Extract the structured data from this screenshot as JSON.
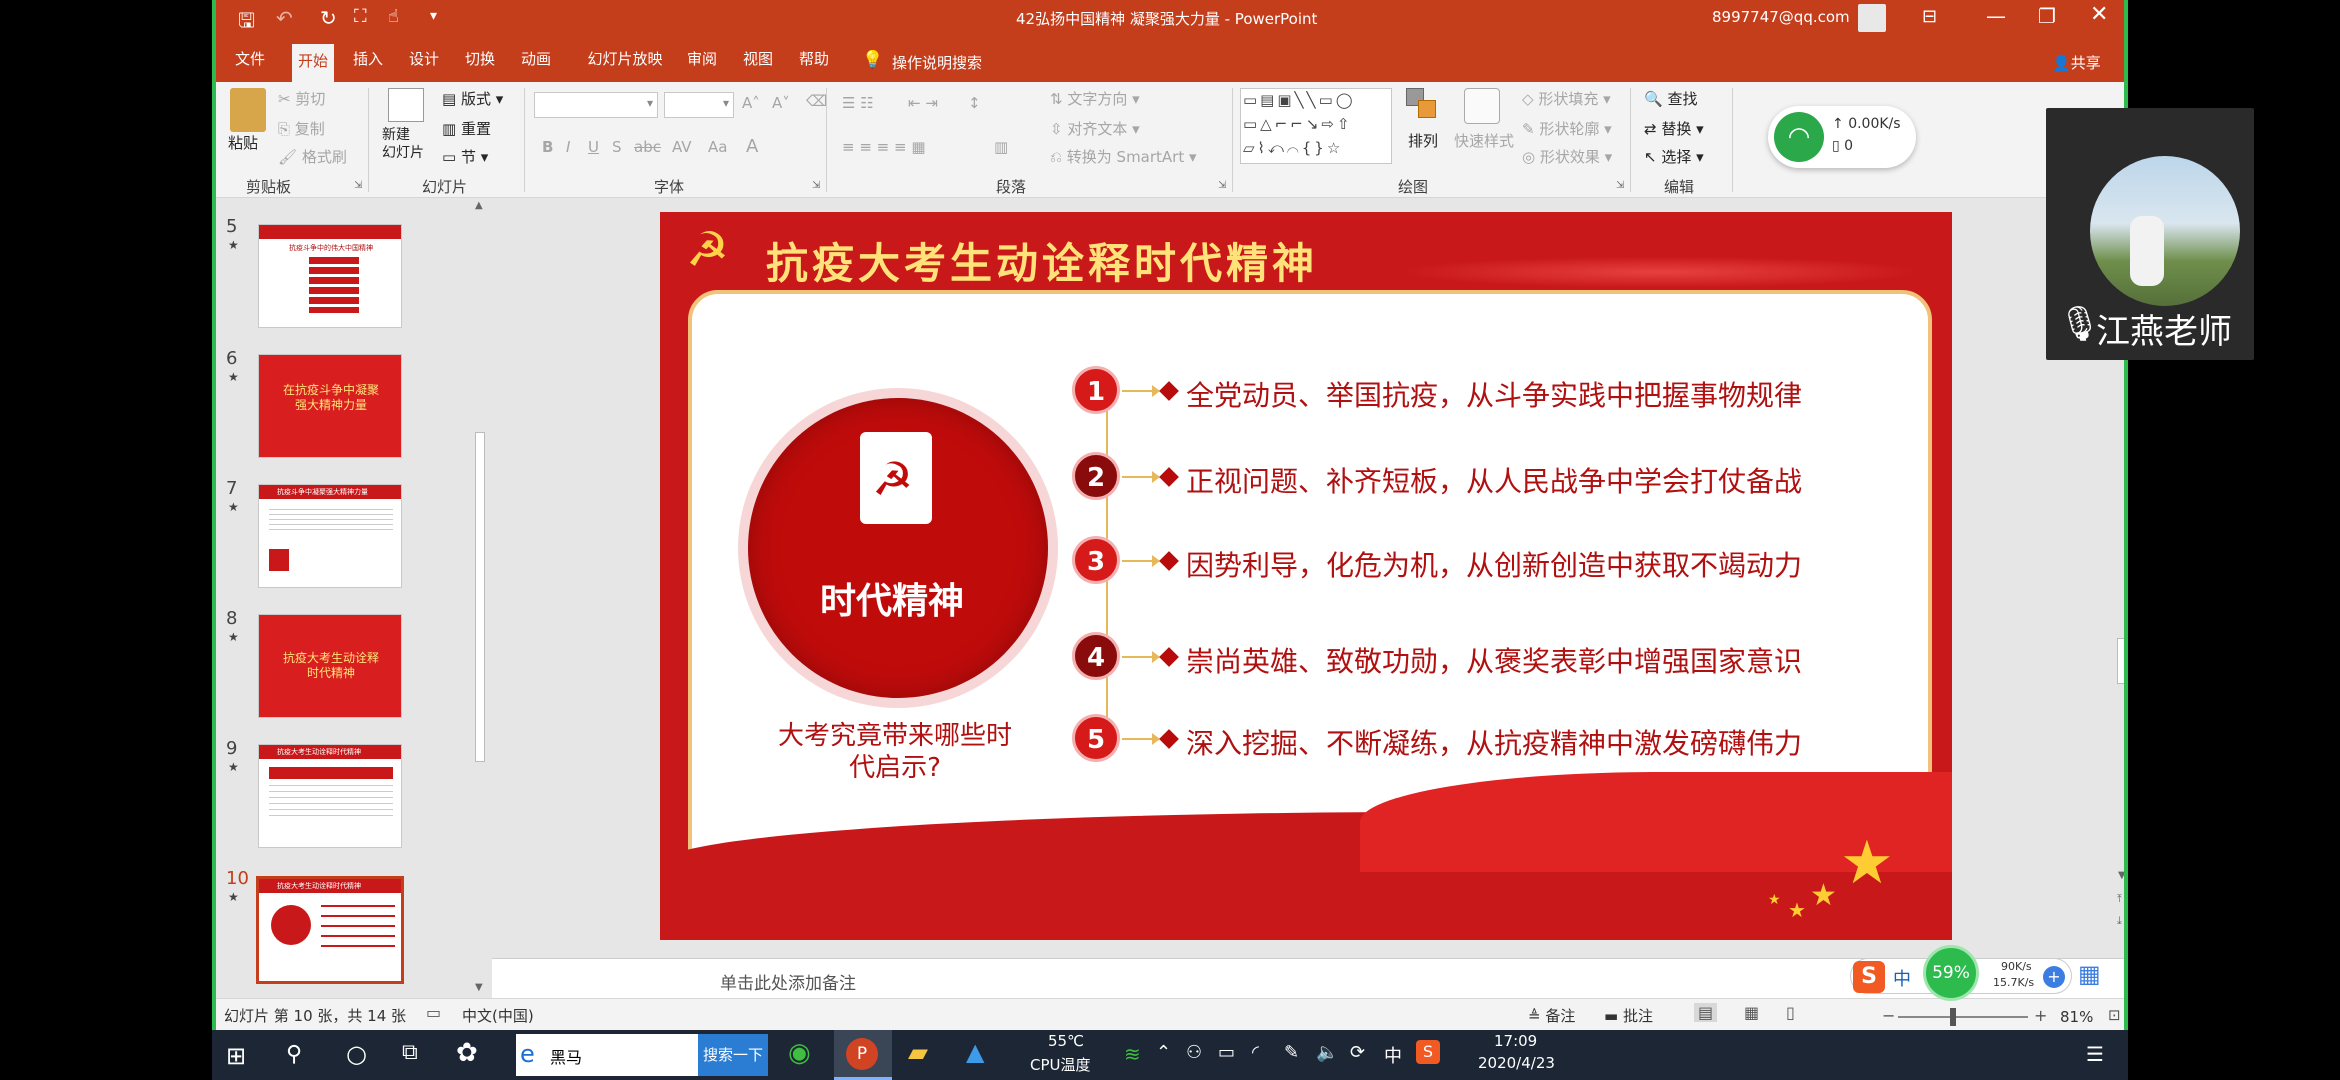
{
  "window": {
    "title": "42弘扬中国精神 凝聚强大力量 - PowerPoint",
    "account": "8997747@qq.com",
    "share_label": "共享"
  },
  "tabs": [
    "文件",
    "开始",
    "插入",
    "设计",
    "切换",
    "动画",
    "幻灯片放映",
    "审阅",
    "视图",
    "帮助"
  ],
  "active_tab": "开始",
  "tell_me": "操作说明搜索",
  "ribbon": {
    "clipboard": {
      "paste": "粘贴",
      "cut": "剪切",
      "copy": "复制",
      "format_painter": "格式刷",
      "label": "剪贴板"
    },
    "slides": {
      "new_slide": "新建\n幻灯片",
      "layout": "版式",
      "reset": "重置",
      "section": "节",
      "label": "幻灯片"
    },
    "font": {
      "label": "字体"
    },
    "paragraph": {
      "text_direction": "文字方向",
      "align_text": "对齐文本",
      "smartart": "转换为 SmartArt",
      "label": "段落"
    },
    "drawing": {
      "arrange": "排列",
      "quick_styles": "快速样式",
      "fill": "形状填充",
      "outline": "形状轮廓",
      "effects": "形状效果",
      "label": "绘图"
    },
    "editing": {
      "find": "查找",
      "replace": "替换",
      "select": "选择",
      "label": "编辑"
    }
  },
  "net_widget": {
    "up": "0.00K/s",
    "down": "0"
  },
  "video": {
    "name": "江燕老师"
  },
  "thumbnails": [
    {
      "num": "5",
      "title": "抗疫斗争中的伟大中国精神"
    },
    {
      "num": "6",
      "title": "在抗疫斗争中凝聚强大精神力量"
    },
    {
      "num": "7",
      "title": "抗疫斗争中凝聚强大精神力量"
    },
    {
      "num": "8",
      "title": "抗疫大考生动诠释时代精神"
    },
    {
      "num": "9",
      "title": "抗疫大考生动诠释时代精神"
    },
    {
      "num": "10",
      "title": "抗疫大考生动诠释时代精神"
    }
  ],
  "slide": {
    "title": "抗疫大考生动诠释时代精神",
    "circle_label": "时代精神",
    "question": "大考究竟带来哪些时代启示?",
    "items": [
      {
        "n": "1",
        "text": "全党动员、举国抗疫，从斗争实践中把握事物规律"
      },
      {
        "n": "2",
        "text": "正视问题、补齐短板，从人民战争中学会打仗备战"
      },
      {
        "n": "3",
        "text": "因势利导，化危为机，从创新创造中获取不竭动力"
      },
      {
        "n": "4",
        "text": "崇尚英雄、致敬功勋，从褒奖表彰中增强国家意识"
      },
      {
        "n": "5",
        "text": "深入挖掘、不断凝练，从抗疫精神中激发磅礴伟力"
      }
    ]
  },
  "notes_placeholder": "单击此处添加备注",
  "status": {
    "slide_info": "幻灯片 第 10 张，共 14 张",
    "language": "中文(中国)",
    "notes": "备注",
    "comments": "批注",
    "zoom": "81%"
  },
  "ime": {
    "mode": "中",
    "cpu": "59%",
    "up": "90K/s",
    "down": "15.7K/s"
  },
  "taskbar": {
    "search_text": "黑马",
    "search_button": "搜索一下",
    "temp": "55℃",
    "temp_label": "CPU温度",
    "lang": "中",
    "time": "17:09",
    "date": "2020/4/23"
  },
  "colors": {
    "office_red": "#c43e1c",
    "slide_red": "#c9181a",
    "dark_red": "#b01010"
  }
}
